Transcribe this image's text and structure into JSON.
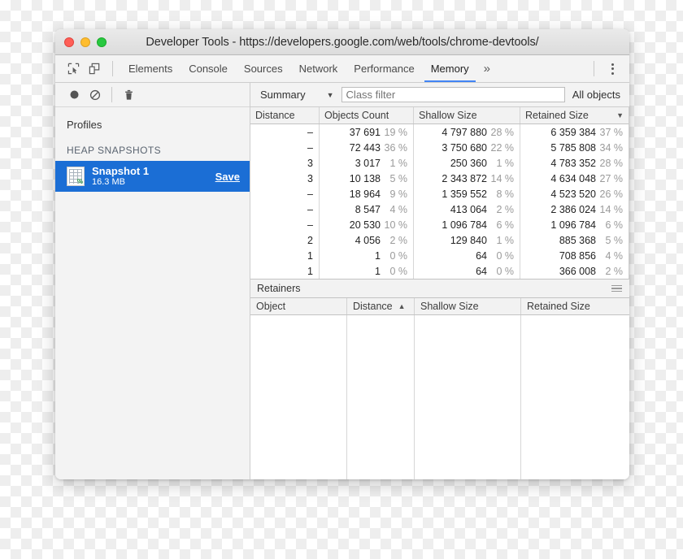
{
  "window": {
    "title": "Developer Tools - https://developers.google.com/web/tools/chrome-devtools/",
    "traffic_lights": [
      "close-button",
      "minimize-button",
      "maximize-button"
    ]
  },
  "tabbar": {
    "inspect_icon": "inspect-element-icon",
    "device_icon": "device-toolbar-icon",
    "tabs": [
      {
        "label": "Elements",
        "active": false
      },
      {
        "label": "Console",
        "active": false
      },
      {
        "label": "Sources",
        "active": false
      },
      {
        "label": "Network",
        "active": false
      },
      {
        "label": "Performance",
        "active": false
      },
      {
        "label": "Memory",
        "active": true
      }
    ],
    "more_tabs": "»",
    "menu_icon": "kebab-menu-icon",
    "active_underline_color": "#4285f4"
  },
  "sidebar": {
    "toolbar": {
      "record_icon": "record-icon",
      "clear_icon": "clear-icon",
      "delete_icon": "trash-icon"
    },
    "profiles_label": "Profiles",
    "section_label": "HEAP SNAPSHOTS",
    "snapshot": {
      "name": "Snapshot 1",
      "size": "16.3 MB",
      "save_label": "Save",
      "icon": "heap-snapshot-icon",
      "selected_color": "#1b6ed5"
    }
  },
  "summary_toolbar": {
    "view_mode": "Summary",
    "view_caret": "▼",
    "filter_placeholder": "Class filter",
    "filter_value": "",
    "objects_scope": "All objects"
  },
  "table": {
    "columns": [
      {
        "label": "Distance",
        "sort": ""
      },
      {
        "label": "Objects Count",
        "sort": ""
      },
      {
        "label": "Shallow Size",
        "sort": ""
      },
      {
        "label": "Retained Size",
        "sort": "▼"
      }
    ],
    "rows": [
      {
        "distance": "–",
        "count": "37 691",
        "count_pct": "19 %",
        "shallow": "4 797 880",
        "shallow_pct": "28 %",
        "retained": "6 359 384",
        "retained_pct": "37 %"
      },
      {
        "distance": "–",
        "count": "72 443",
        "count_pct": "36 %",
        "shallow": "3 750 680",
        "shallow_pct": "22 %",
        "retained": "5 785 808",
        "retained_pct": "34 %"
      },
      {
        "distance": "3",
        "count": "3 017",
        "count_pct": "1 %",
        "shallow": "250 360",
        "shallow_pct": "1 %",
        "retained": "4 783 352",
        "retained_pct": "28 %"
      },
      {
        "distance": "3",
        "count": "10 138",
        "count_pct": "5 %",
        "shallow": "2 343 872",
        "shallow_pct": "14 %",
        "retained": "4 634 048",
        "retained_pct": "27 %"
      },
      {
        "distance": "–",
        "count": "18 964",
        "count_pct": "9 %",
        "shallow": "1 359 552",
        "shallow_pct": "8 %",
        "retained": "4 523 520",
        "retained_pct": "26 %"
      },
      {
        "distance": "–",
        "count": "8 547",
        "count_pct": "4 %",
        "shallow": "413 064",
        "shallow_pct": "2 %",
        "retained": "2 386 024",
        "retained_pct": "14 %"
      },
      {
        "distance": "–",
        "count": "20 530",
        "count_pct": "10 %",
        "shallow": "1 096 784",
        "shallow_pct": "6 %",
        "retained": "1 096 784",
        "retained_pct": "6 %"
      },
      {
        "distance": "2",
        "count": "4 056",
        "count_pct": "2 %",
        "shallow": "129 840",
        "shallow_pct": "1 %",
        "retained": "885 368",
        "retained_pct": "5 %"
      },
      {
        "distance": "1",
        "count": "1",
        "count_pct": "0 %",
        "shallow": "64",
        "shallow_pct": "0 %",
        "retained": "708 856",
        "retained_pct": "4 %"
      },
      {
        "distance": "1",
        "count": "1",
        "count_pct": "0 %",
        "shallow": "64",
        "shallow_pct": "0 %",
        "retained": "366 008",
        "retained_pct": "2 %"
      }
    ]
  },
  "retainers": {
    "title": "Retainers",
    "menu_icon": "hamburger-menu-icon",
    "columns": [
      {
        "label": "Object",
        "sort": ""
      },
      {
        "label": "Distance",
        "sort": "▲"
      },
      {
        "label": "Shallow Size",
        "sort": ""
      },
      {
        "label": "Retained Size",
        "sort": ""
      }
    ],
    "rows": []
  }
}
